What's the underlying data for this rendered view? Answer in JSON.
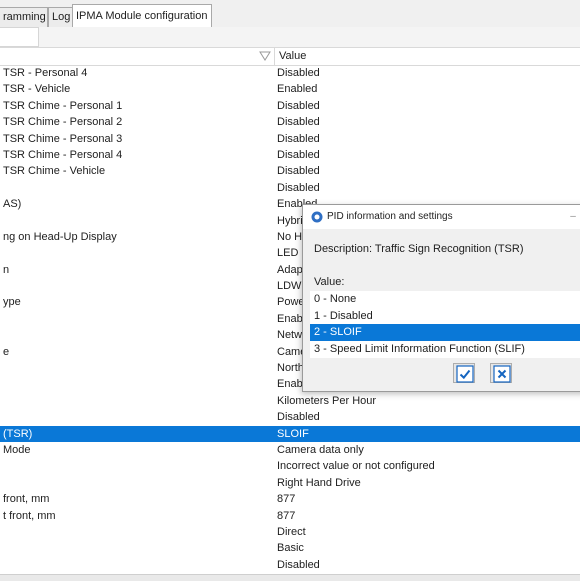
{
  "tabs": [
    {
      "label": "ramming",
      "active": false
    },
    {
      "label": "Log",
      "active": false
    },
    {
      "label": "IPMA Module configuration",
      "active": true
    }
  ],
  "grid": {
    "header": {
      "name": "",
      "value": "Value"
    },
    "rows": [
      {
        "name": "TSR - Personal 4",
        "value": "Disabled",
        "selected": false
      },
      {
        "name": "TSR - Vehicle",
        "value": "Enabled",
        "selected": false
      },
      {
        "name": "TSR Chime - Personal 1",
        "value": "Disabled",
        "selected": false
      },
      {
        "name": "TSR Chime - Personal 2",
        "value": "Disabled",
        "selected": false
      },
      {
        "name": "TSR Chime - Personal 3",
        "value": "Disabled",
        "selected": false
      },
      {
        "name": "TSR Chime - Personal 4",
        "value": "Disabled",
        "selected": false
      },
      {
        "name": "TSR Chime - Vehicle",
        "value": "Disabled",
        "selected": false
      },
      {
        "name": "",
        "value": "Disabled",
        "selected": false
      },
      {
        "name": "AS)",
        "value": "Enabled",
        "selected": false
      },
      {
        "name": "",
        "value": "Hybri",
        "selected": false
      },
      {
        "name": "ng on Head-Up Display",
        "value": "No He",
        "selected": false
      },
      {
        "name": "",
        "value": "LED",
        "selected": false
      },
      {
        "name": "n",
        "value": "Adap",
        "selected": false
      },
      {
        "name": "",
        "value": "LDW",
        "selected": false
      },
      {
        "name": "ype",
        "value": "Powe",
        "selected": false
      },
      {
        "name": "",
        "value": "Enab",
        "selected": false
      },
      {
        "name": "",
        "value": "Netw",
        "selected": false
      },
      {
        "name": "e",
        "value": "Came",
        "selected": false
      },
      {
        "name": "",
        "value": "North",
        "selected": false
      },
      {
        "name": "",
        "value": "Enab",
        "selected": false
      },
      {
        "name": "",
        "value": "Kilometers Per Hour",
        "selected": false
      },
      {
        "name": "",
        "value": "Disabled",
        "selected": false
      },
      {
        "name": "(TSR)",
        "value": "SLOIF",
        "selected": true
      },
      {
        "name": "Mode",
        "value": "Camera data only",
        "selected": false
      },
      {
        "name": "",
        "value": "Incorrect value or not configured",
        "selected": false
      },
      {
        "name": "",
        "value": "Right Hand Drive",
        "selected": false
      },
      {
        "name": "front, mm",
        "value": "877",
        "selected": false
      },
      {
        "name": "t front, mm",
        "value": "877",
        "selected": false
      },
      {
        "name": "",
        "value": "Direct",
        "selected": false
      },
      {
        "name": "",
        "value": "Basic",
        "selected": false
      },
      {
        "name": "",
        "value": "Disabled",
        "selected": false
      }
    ]
  },
  "dialog": {
    "title": "PID information and settings",
    "close_glyph": "–",
    "description": "Description: Traffic Sign Recognition (TSR)",
    "value_label": "Value:",
    "options": [
      {
        "label": "0 - None",
        "selected": false
      },
      {
        "label": "1 - Disabled",
        "selected": false
      },
      {
        "label": "2 - SLOIF",
        "selected": true
      },
      {
        "label": "3 - Speed Limit Information Function (SLIF)",
        "selected": false
      }
    ],
    "ok_icon": "check-icon",
    "cancel_icon": "x-icon"
  },
  "colors": {
    "selection": "#0a78d7",
    "ok_icon": "#1565c0",
    "cancel_icon": "#1565c0"
  }
}
